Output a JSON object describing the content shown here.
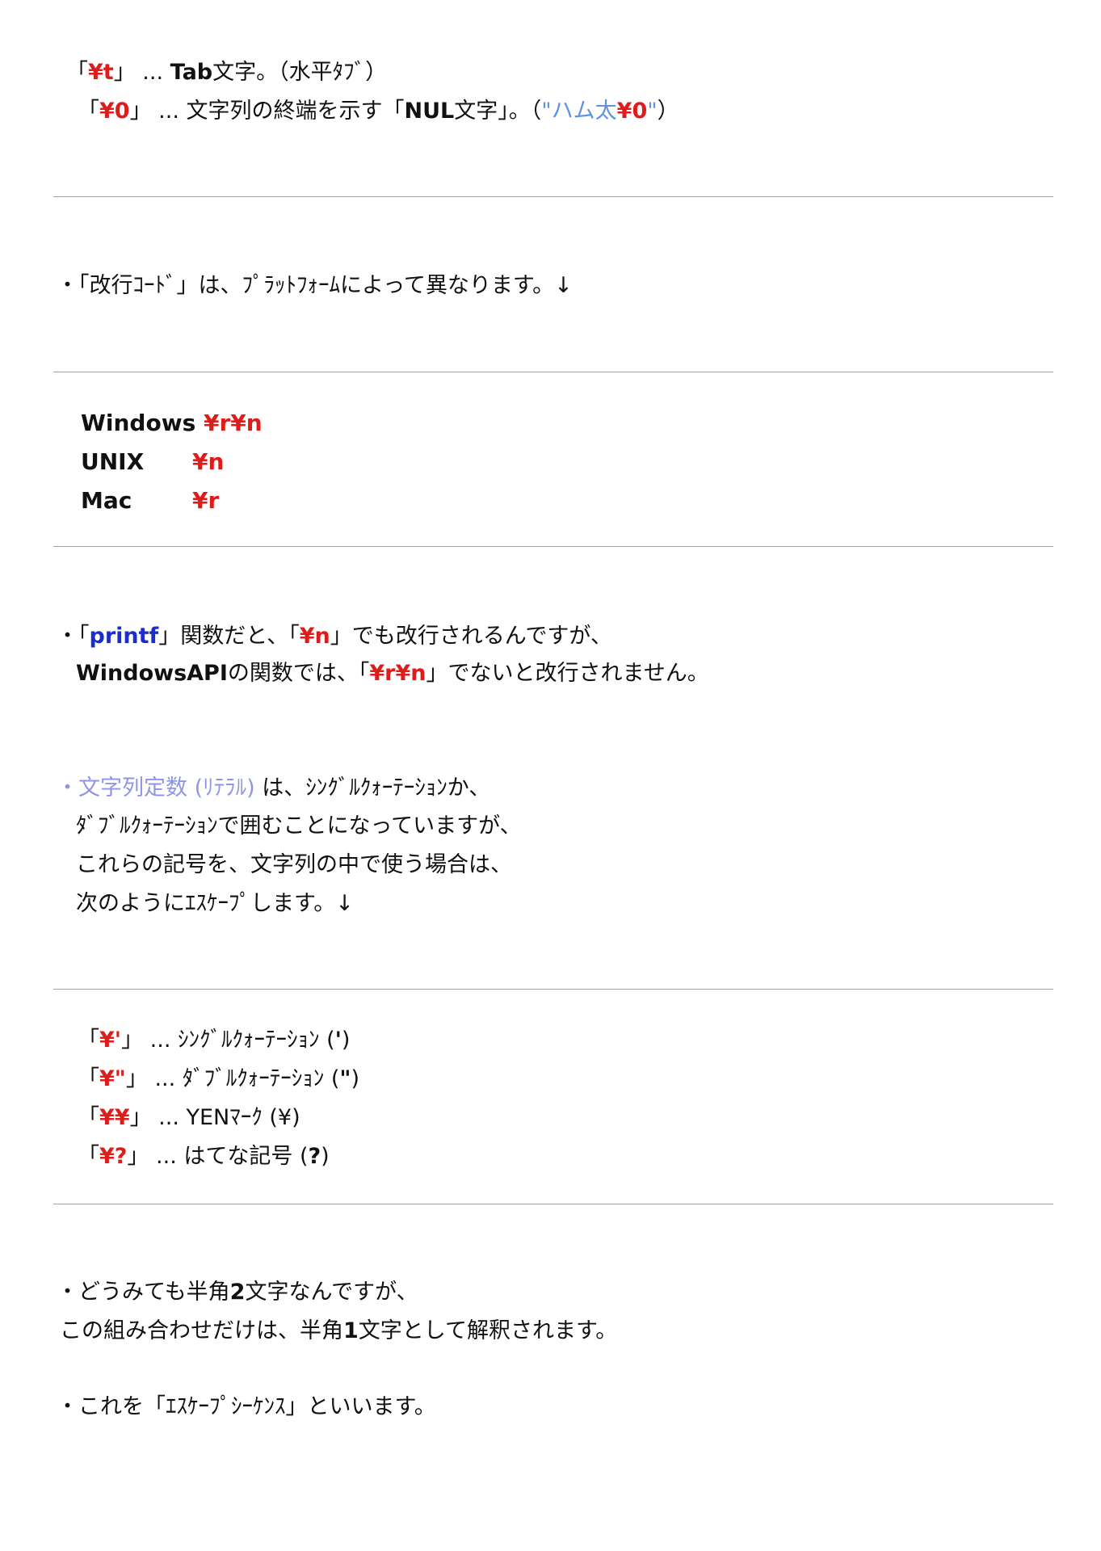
{
  "escape_basic": {
    "tab_code": "¥t",
    "tab_desc_prefix": "... ",
    "tab_name": "Tab",
    "tab_desc": "文字。（水平ﾀﾌﾞ）",
    "nul_code": "¥0",
    "nul_desc_prefix": "... 文字列の終端を示す「",
    "nul_name": "NUL",
    "nul_desc_mid": "文字」。（",
    "nul_example_text": "\"ハム太",
    "nul_example_code": "¥0",
    "nul_example_quote": "\"",
    "nul_desc_end": "）"
  },
  "newline_note": "・「改行ｺｰﾄﾞ」は、ﾌﾟﾗｯﾄﾌｫｰﾑによって異なります。↓",
  "newline_table": [
    {
      "platform": "Windows",
      "code": "¥r¥n"
    },
    {
      "platform": "UNIX",
      "code": "¥n"
    },
    {
      "platform": "Mac",
      "code": "¥r"
    }
  ],
  "printf_note": {
    "p1": "・「",
    "func": "printf",
    "p2": "」関数だと、「",
    "code1": "¥n",
    "p3": "」でも改行されるんですが、",
    "l2_api": "WindowsAPI",
    "l2_p1": "の関数では、「",
    "code2": "¥r¥n",
    "l2_p2": "」でないと改行されません。"
  },
  "literal_note": {
    "bullet": "・",
    "highlight": "文字列定数 (ﾘﾃﾗﾙ)",
    "line1_rest": " は、ｼﾝｸﾞﾙｸｫｰﾃｰｼｮﾝか、",
    "line2": "ﾀﾞﾌﾞﾙｸｫｰﾃｰｼｮﾝで囲むことになっていますが、",
    "line3": "これらの記号を、文字列の中で使う場合は、",
    "line4": "次のようにｴｽｹｰﾌﾟします。↓"
  },
  "escape_symbols": [
    {
      "code": "¥'",
      "desc": " ... ｼﾝｸﾞﾙｸｫｰﾃｰｼｮﾝ (",
      "sym": "'",
      "end": ")"
    },
    {
      "code": "¥\"",
      "desc": " ... ﾀﾞﾌﾞﾙｸｫｰﾃｰｼｮﾝ (",
      "sym": "\"",
      "end": ")"
    },
    {
      "code": "¥¥",
      "desc": "... YENﾏｰｸ (",
      "sym": "¥",
      "end": ")"
    },
    {
      "code": "¥?",
      "desc": " ... はてな記号 (",
      "sym": "?",
      "end": ")"
    }
  ],
  "summary": {
    "l1_a": "・どうみても半角",
    "l1_num": "2",
    "l1_b": "文字なんですが、",
    "l2_a": "この組み合わせだけは、半角",
    "l2_num": "1",
    "l2_b": "文字として解釈されます。",
    "l3": "・これを「ｴｽｹｰﾌﾟｼｰｹﾝｽ」といいます。"
  }
}
